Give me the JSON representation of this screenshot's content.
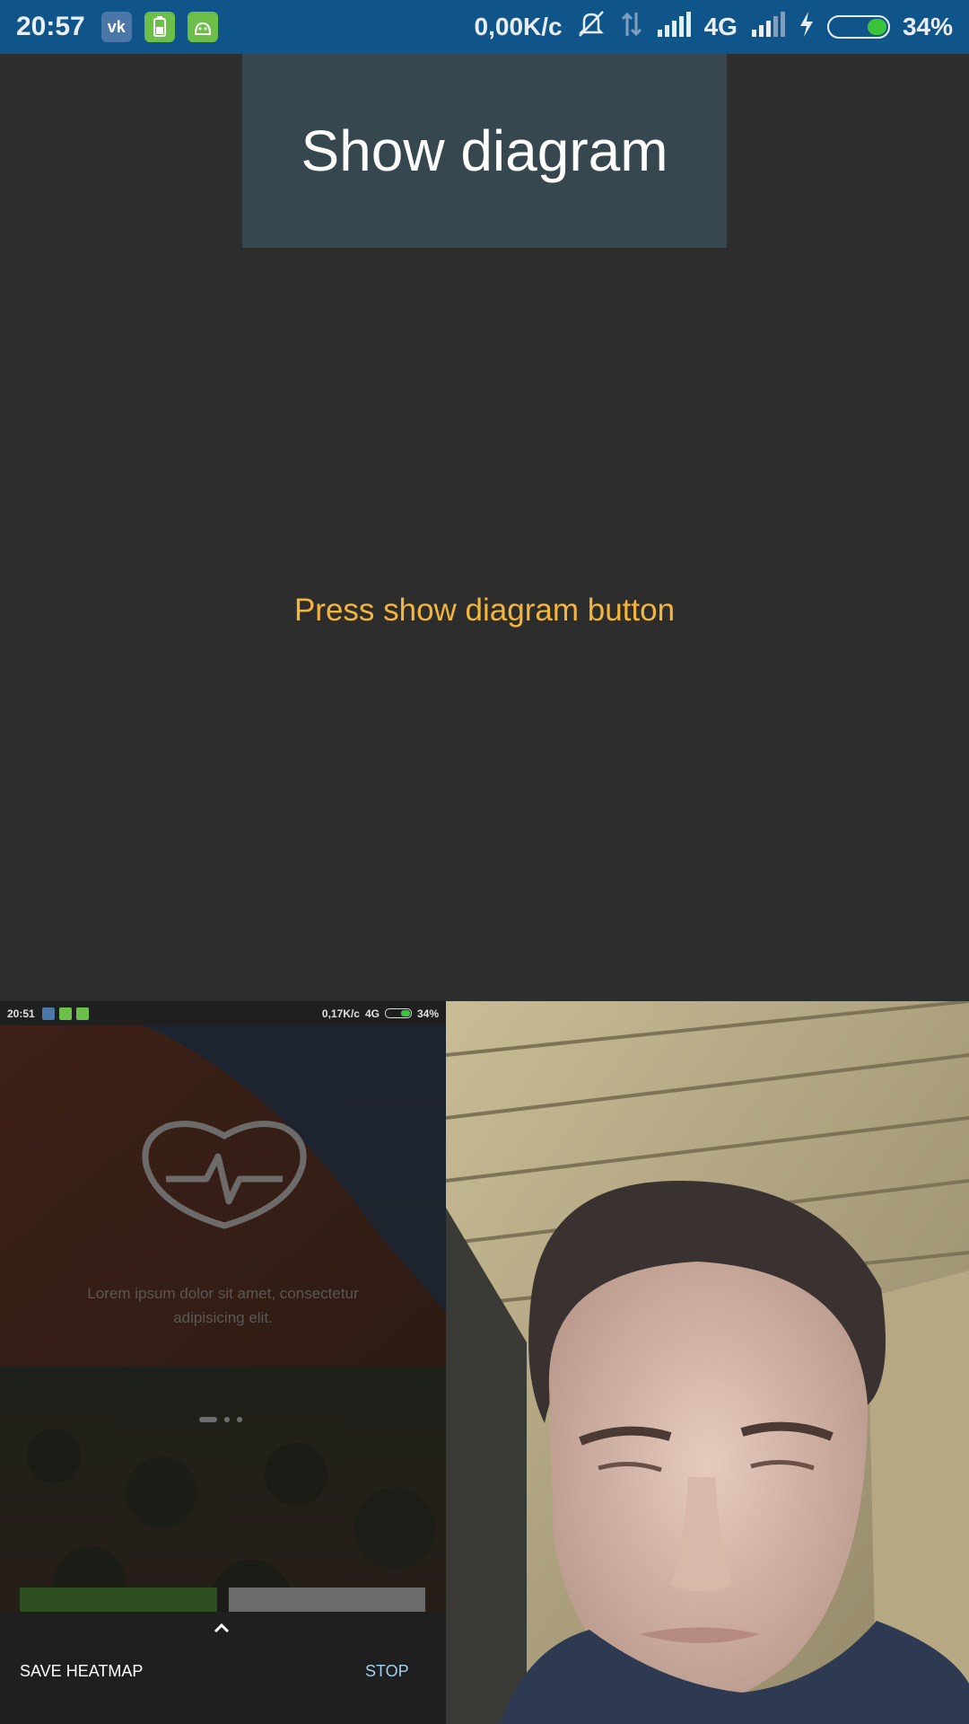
{
  "status_bar": {
    "time": "20:57",
    "app_icons": [
      "vk-icon",
      "battery-app-icon",
      "android-icon"
    ],
    "speed": "0,00K/с",
    "network": "4G",
    "battery": "34%",
    "battery_level": 0.34,
    "color": "#10558a"
  },
  "main": {
    "button_label": "Show diagram",
    "hint": "Press show diagram button",
    "hint_color": "#f3b53a",
    "button_color": "#37474f"
  },
  "mini_screen": {
    "status_time": "20:51",
    "status_speed": "0,17K/с",
    "status_network": "4G",
    "status_battery": "34%",
    "lorem": "Lorem ipsum dolor sit amet, consectetur adipisicing elit.",
    "save_label": "SAVE HEATMAP",
    "stop_label": "STOP"
  }
}
